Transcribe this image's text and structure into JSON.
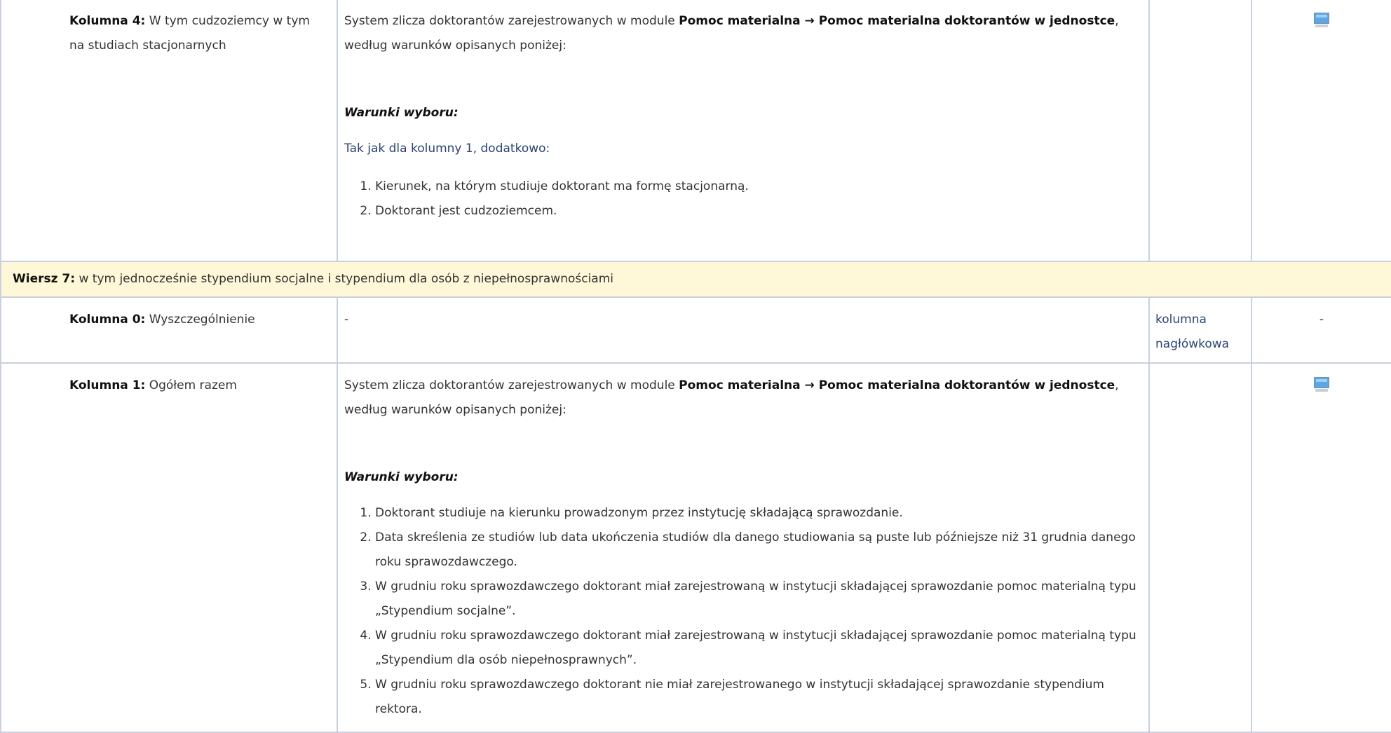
{
  "rows": {
    "col4": {
      "label_bold": "Kolumna 4:",
      "label_text": " W tym cudzoziemcy w tym na studiach stacjonarnych",
      "desc_pre": "System zlicza doktorantów zarejestrowanych w module ",
      "desc_path": "Pomoc materialna → Pomoc materialna doktorantów w jednostce",
      "desc_post": ", według warunków opisanych poniżej:",
      "cond_title": "Warunki wyboru:",
      "note": "Tak jak dla kolumny 1, dodatkowo:",
      "conditions": [
        "Kierunek, na którym studiuje doktorant ma formę stacjonarną.",
        "Doktorant jest cudzoziemcem."
      ],
      "source": "",
      "icon": "computer-icon"
    },
    "wiersz7": {
      "label_bold": "Wiersz 7:",
      "label_text": " w tym jednocześnie stypendium socjalne i stypendium dla osób z niepełnosprawnościami"
    },
    "col0": {
      "label_bold": "Kolumna 0:",
      "label_text": " Wyszczególnienie",
      "desc": "-",
      "source": "kolumna nagłówkowa",
      "icon_text": "-"
    },
    "col1": {
      "label_bold": "Kolumna 1:",
      "label_text": " Ogółem razem",
      "desc_pre": "System zlicza doktorantów zarejestrowanych w module ",
      "desc_path": "Pomoc materialna → Pomoc materialna doktorantów w jednostce",
      "desc_post": ", według warunków opisanych poniżej:",
      "cond_title": "Warunki wyboru:",
      "conditions": [
        "Doktorant studiuje na kierunku prowadzonym przez instytucję składającą sprawozdanie.",
        "Data skreślenia ze studiów lub data ukończenia studiów dla danego studiowania są puste lub późniejsze niż 31 grudnia danego roku sprawozdawczego.",
        "W grudniu roku sprawozdawczego doktorant miał zarejestrowaną w instytucji składającej sprawozdanie pomoc materialną typu „Stypendium socjalne”.",
        "W grudniu roku sprawozdawczego doktorant miał zarejestrowaną w instytucji składającej sprawozdanie pomoc materialną typu „Stypendium dla osób niepełnosprawnych”.",
        "W grudniu roku sprawozdawczego doktorant nie miał zarejestrowanego w instytucji składającej sprawozdanie stypendium rektora."
      ],
      "source": "",
      "icon": "computer-icon"
    }
  }
}
